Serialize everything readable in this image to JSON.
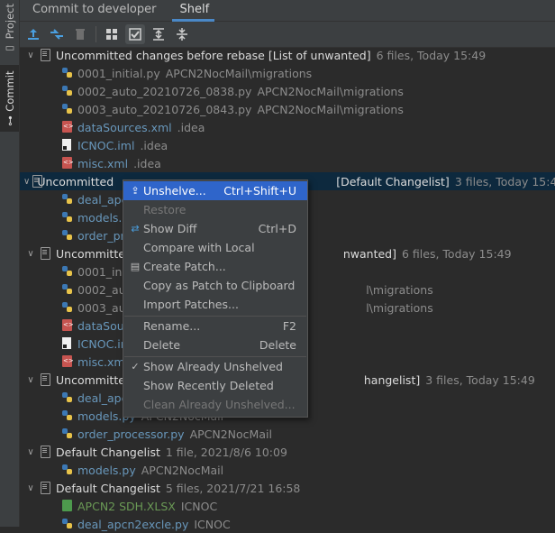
{
  "sidebar": {
    "project_label": "Project",
    "commit_label": "Commit"
  },
  "tabs": [
    {
      "label": "Commit to developer"
    },
    {
      "label": "Shelf"
    }
  ],
  "toolbar": {
    "icons": [
      "unshelve-icon",
      "show-diff-icon",
      "delete-icon",
      "group-by-icon",
      "show-recently-deleted-icon",
      "expand-all-icon",
      "collapse-all-icon"
    ]
  },
  "tree": {
    "groups": [
      {
        "name": "Uncommitted changes before rebase [List of unwanted]",
        "meta": "6 files, Today 15:49",
        "files": [
          {
            "name": "0001_initial.py",
            "path": "APCN2NocMail\\migrations",
            "type": "py",
            "color": "gray"
          },
          {
            "name": "0002_auto_20210726_0838.py",
            "path": "APCN2NocMail\\migrations",
            "type": "py",
            "color": "gray"
          },
          {
            "name": "0003_auto_20210726_0843.py",
            "path": "APCN2NocMail\\migrations",
            "type": "py",
            "color": "gray"
          },
          {
            "name": "dataSources.xml",
            "path": ".idea",
            "type": "xml",
            "color": "blue"
          },
          {
            "name": "ICNOC.iml",
            "path": ".idea",
            "type": "iml",
            "color": "blue"
          },
          {
            "name": "misc.xml",
            "path": ".idea",
            "type": "xml",
            "color": "blue"
          }
        ]
      },
      {
        "name": "Uncommitted changes before rebase [Default Changelist]",
        "name_visible": "Uncommitted",
        "name_tail": "[Default Changelist]",
        "meta": "3 files, Today 15:49",
        "files": [
          {
            "name": "deal_apcn",
            "path": "",
            "type": "py",
            "color": "blue"
          },
          {
            "name": "models.py",
            "path": "",
            "type": "py",
            "color": "blue"
          },
          {
            "name": "order_pro",
            "path": "",
            "type": "py",
            "color": "blue"
          }
        ]
      },
      {
        "name_visible": "Uncommitted",
        "name_tail": "nwanted]",
        "meta": "6 files, Today 15:49",
        "files": [
          {
            "name": "0001_initi",
            "path": "",
            "type": "py",
            "color": "gray"
          },
          {
            "name": "0002_auto",
            "path": "l\\migrations",
            "type": "py",
            "color": "gray"
          },
          {
            "name": "0003_auto",
            "path": "l\\migrations",
            "type": "py",
            "color": "gray"
          },
          {
            "name": "dataSour",
            "path": "",
            "type": "xml",
            "color": "blue"
          },
          {
            "name": "ICNOC.im",
            "path": "",
            "type": "iml",
            "color": "blue"
          },
          {
            "name": "misc.xml",
            "path": "",
            "type": "xml",
            "color": "blue"
          }
        ]
      },
      {
        "name_visible": "Uncommitted",
        "name_tail": "hangelist]",
        "meta": "3 files, Today 15:49",
        "files": [
          {
            "name": "deal_apcn",
            "path": "",
            "type": "py",
            "color": "blue"
          },
          {
            "name": "models.py",
            "path": "APCN2NocMail",
            "type": "py",
            "color": "blue"
          },
          {
            "name": "order_processor.py",
            "path": "APCN2NocMail",
            "type": "py",
            "color": "blue"
          }
        ]
      },
      {
        "name": "Default Changelist",
        "meta": "1 file, 2021/8/6 10:09",
        "files": [
          {
            "name": "models.py",
            "path": "APCN2NocMail",
            "type": "py",
            "color": "blue"
          }
        ]
      },
      {
        "name": "Default Changelist",
        "meta": "5 files, 2021/7/21 16:58",
        "files": [
          {
            "name": "APCN2 SDH.XLSX",
            "path": "ICNOC",
            "type": "xls",
            "color": "green"
          },
          {
            "name": "deal_apcn2excle.py",
            "path": "ICNOC",
            "type": "py",
            "color": "blue"
          }
        ]
      }
    ]
  },
  "context_menu": {
    "items": [
      {
        "label": "Unshelve...",
        "shortcut": "Ctrl+Shift+U",
        "icon": "unshelve-icon",
        "highlighted": true,
        "enabled": true
      },
      {
        "label": "Restore",
        "shortcut": "",
        "icon": "",
        "enabled": false
      },
      {
        "label": "Show Diff",
        "shortcut": "Ctrl+D",
        "icon": "show-diff-icon",
        "enabled": true
      },
      {
        "label": "Compare with Local",
        "shortcut": "",
        "icon": "",
        "enabled": true
      },
      {
        "label": "Create Patch...",
        "shortcut": "",
        "icon": "patch-icon",
        "enabled": true
      },
      {
        "label": "Copy as Patch to Clipboard",
        "shortcut": "",
        "icon": "",
        "enabled": true
      },
      {
        "label": "Import Patches...",
        "shortcut": "",
        "icon": "",
        "enabled": true
      },
      {
        "label": "Rename...",
        "shortcut": "F2",
        "icon": "",
        "enabled": true
      },
      {
        "label": "Delete",
        "shortcut": "Delete",
        "icon": "",
        "enabled": true
      },
      {
        "label": "Show Already Unshelved",
        "shortcut": "",
        "icon": "check-icon",
        "enabled": true
      },
      {
        "label": "Show Recently Deleted",
        "shortcut": "",
        "icon": "",
        "enabled": true
      },
      {
        "label": "Clean Already Unshelved...",
        "shortcut": "",
        "icon": "",
        "enabled": false
      }
    ]
  },
  "colors": {
    "selection": "#0d293e",
    "menu_highlight": "#2f65ca",
    "tab_underline": "#4a88c7"
  }
}
